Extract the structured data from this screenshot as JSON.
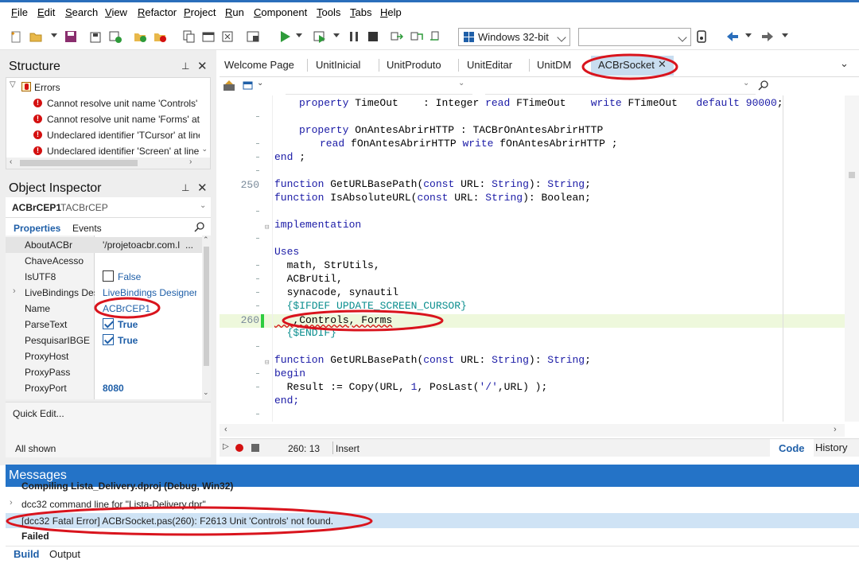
{
  "menu": [
    "File",
    "Edit",
    "Search",
    "View",
    "Refactor",
    "Project",
    "Run",
    "Component",
    "Tools",
    "Tabs",
    "Help"
  ],
  "toolbar": {
    "platform": "Windows 32-bit",
    "config": ""
  },
  "structure": {
    "title": "Structure",
    "root": "Errors",
    "errors": [
      "Cannot resolve unit name 'Controls'",
      "Cannot resolve unit name 'Forms' at",
      "Undeclared identifier 'TCursor' at line",
      "Undeclared identifier 'Screen' at line"
    ]
  },
  "inspector": {
    "title": "Object Inspector",
    "component": "ACBrCEP1",
    "component_type": "TACBrCEP",
    "tab_properties": "Properties",
    "tab_events": "Events",
    "props": [
      {
        "name": "AboutACBr",
        "value": "'/projetoacbr.com.l",
        "extra": "..."
      },
      {
        "name": "ChaveAcesso",
        "value": ""
      },
      {
        "name": "IsUTF8",
        "value": "False"
      },
      {
        "name": "LiveBindings Des",
        "value": "LiveBindings Designer"
      },
      {
        "name": "Name",
        "value": "ACBrCEP1"
      },
      {
        "name": "ParseText",
        "value": "True"
      },
      {
        "name": "PesquisarIBGE",
        "value": "True"
      },
      {
        "name": "ProxyHost",
        "value": ""
      },
      {
        "name": "ProxyPass",
        "value": ""
      },
      {
        "name": "ProxyPort",
        "value": "8080"
      }
    ],
    "quick_edit": "Quick Edit...",
    "all_shown": "All shown"
  },
  "tabs": [
    "Welcome Page",
    "UnitInicial",
    "UnitProduto",
    "UnitEditar",
    "UnitDM",
    "ACBrSocket"
  ],
  "active_tab": "ACBrSocket",
  "code": {
    "line_250": "250",
    "line_260": "260",
    "l1a": "property",
    "l1b": " TimeOut    : Integer ",
    "l1c": "read",
    "l1d": " FTimeOut    ",
    "l1e": "write",
    "l1f": " FTimeOut   ",
    "l1g": "default",
    "l1h": "90000",
    "l1i": ";",
    "l2a": "property",
    "l2b": " OnAntesAbrirHTTP : TACBrOnAntesAbrirHTTP",
    "l3a": "read",
    "l3b": " fOnAntesAbrirHTTP ",
    "l3c": "write",
    "l3d": " fOnAntesAbrirHTTP ;",
    "l4a": "end",
    "l4b": " ;",
    "l5a": "function",
    "l5b": " GetURLBasePath(",
    "l5c": "const",
    "l5d": " URL: ",
    "l5e": "String",
    "l5f": "): ",
    "l5g": "String",
    "l5h": ";",
    "l6a": "function",
    "l6b": " IsAbsoluteURL(",
    "l6c": "const",
    "l6d": " URL: ",
    "l6e": "String",
    "l6f": "): Boolean;",
    "l7": "implementation",
    "l8": "Uses",
    "l9": "  math, StrUtils,",
    "l10": "  ACBrUtil,",
    "l11": "  synacode, synautil",
    "l12": "  {$IFDEF UPDATE_SCREEN_CURSOR}",
    "l13": "   ,Controls, Forms",
    "l14": "  {$ENDIF}",
    "l15a": "function",
    "l15b": " GetURLBasePath(",
    "l15c": "const",
    "l15d": " URL: ",
    "l15e": "String",
    "l15f": "): ",
    "l15g": "String",
    "l15h": ";",
    "l16": "begin",
    "l17a": "  Result := Copy(URL, ",
    "l17b": "1",
    "l17c": ", PosLast(",
    "l17d": "'/'",
    "l17e": ",URL) );",
    "l18": "end;"
  },
  "status": {
    "position": "260: 13",
    "mode": "Insert",
    "code_tab": "Code",
    "history_tab": "History"
  },
  "messages": {
    "title": "Messages",
    "m1": "Compiling Lista_Delivery.dproj (Debug, Win32)",
    "m2": "dcc32 command line for \"Lista-Delivery.dpr\"",
    "m3": "[dcc32 Fatal Error] ACBrSocket.pas(260): F2613 Unit 'Controls' not found.",
    "m4": "Failed",
    "tab_build": "Build",
    "tab_output": "Output"
  },
  "colors": {
    "accent": "#2473c7",
    "annotation": "#d9141d",
    "current_line": "#eef8dc",
    "active_tab": "#c8ddf0"
  }
}
